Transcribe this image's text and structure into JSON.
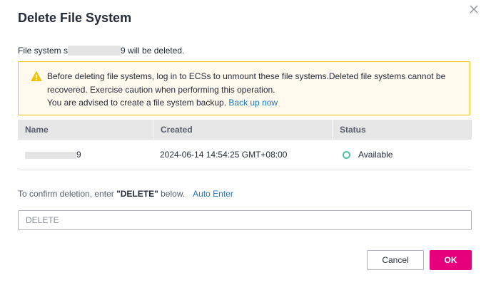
{
  "dialog": {
    "title": "Delete File System",
    "close_icon": "close-icon"
  },
  "summary": {
    "prefix": "File system ",
    "name_visible_start": "s",
    "name_visible_end": "9",
    "suffix": " will be deleted."
  },
  "alert": {
    "icon": "warning-icon",
    "line1": "Before deleting file systems, log in to ECSs to unmount these file systems.Deleted file systems cannot be recovered. Exercise caution when performing this operation.",
    "line2": "You are advised to create a file system backup.",
    "backup_link": "Back up now",
    "colors": {
      "border": "#f2c200",
      "background": "#fffaed",
      "icon": "#f2c200"
    }
  },
  "table": {
    "columns": [
      "Name",
      "Created",
      "Status"
    ],
    "rows": [
      {
        "name_visible_end": "9",
        "created": "2024-06-14 14:54:25 GMT+08:00",
        "status": "Available",
        "status_color": "#4cc2a2"
      }
    ]
  },
  "confirm": {
    "text_prefix": "To confirm deletion, enter ",
    "keyword": "\"DELETE\"",
    "text_suffix": " below.",
    "auto_enter": "Auto Enter",
    "input_placeholder": "DELETE",
    "input_value": ""
  },
  "buttons": {
    "cancel": "Cancel",
    "ok": "OK",
    "ok_color": "#e6007e"
  },
  "colors": {
    "link": "#1476ce"
  }
}
